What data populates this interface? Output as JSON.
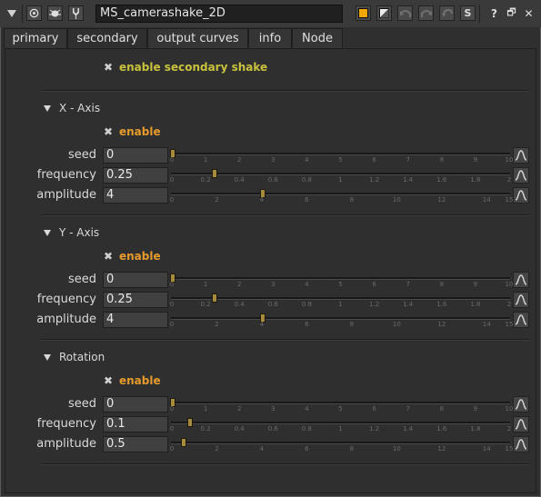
{
  "toolbar": {
    "node_name": "MS_camerashake_2D",
    "icons": [
      "collapse-triangle-icon",
      "center-node-icon",
      "float-panel-icon",
      "settings-icon",
      "node-color-icon",
      "hide-input-icon",
      "undo-icon",
      "redo-icon",
      "revert-icon",
      "s-icon",
      "help-icon",
      "float-icon",
      "close-icon"
    ],
    "s_label": "S",
    "help_label": "?",
    "float_label": "🗗",
    "close_label": "✕"
  },
  "tabs": [
    "primary",
    "secondary",
    "output curves",
    "info",
    "Node"
  ],
  "active_tab": "secondary",
  "secondary": {
    "enable_label": "enable secondary shake",
    "enable_checked": true
  },
  "sections": [
    {
      "title": "X - Axis",
      "enable_label": "enable",
      "rows": [
        {
          "label": "seed",
          "value": "0",
          "fraction": 0.0,
          "ticks": [
            "0",
            "1",
            "2",
            "3",
            "4",
            "5",
            "6",
            "7",
            "8",
            "9",
            "10"
          ]
        },
        {
          "label": "frequency",
          "value": "0.25",
          "fraction": 0.125,
          "ticks": [
            "0",
            "0.2",
            "0.4",
            "0.6",
            "0.8",
            "1",
            "1.2",
            "1.4",
            "1.6",
            "1.8",
            "2"
          ]
        },
        {
          "label": "amplitude",
          "value": "4",
          "fraction": 0.2667,
          "ticks": [
            "0",
            "2",
            "4",
            "6",
            "8",
            "10",
            "12",
            "14",
            "15"
          ]
        }
      ]
    },
    {
      "title": "Y - Axis",
      "enable_label": "enable",
      "rows": [
        {
          "label": "seed",
          "value": "0",
          "fraction": 0.0,
          "ticks": [
            "0",
            "1",
            "2",
            "3",
            "4",
            "5",
            "6",
            "7",
            "8",
            "9",
            "10"
          ]
        },
        {
          "label": "frequency",
          "value": "0.25",
          "fraction": 0.125,
          "ticks": [
            "0",
            "0.2",
            "0.4",
            "0.6",
            "0.8",
            "1",
            "1.2",
            "1.4",
            "1.6",
            "1.8",
            "2"
          ]
        },
        {
          "label": "amplitude",
          "value": "4",
          "fraction": 0.2667,
          "ticks": [
            "0",
            "2",
            "4",
            "6",
            "8",
            "10",
            "12",
            "14",
            "15"
          ]
        }
      ]
    },
    {
      "title": "Rotation",
      "enable_label": "enable",
      "rows": [
        {
          "label": "seed",
          "value": "0",
          "fraction": 0.0,
          "ticks": [
            "0",
            "1",
            "2",
            "3",
            "4",
            "5",
            "6",
            "7",
            "8",
            "9",
            "10"
          ]
        },
        {
          "label": "frequency",
          "value": "0.1",
          "fraction": 0.05,
          "ticks": [
            "0",
            "0.2",
            "0.4",
            "0.6",
            "0.8",
            "1",
            "1.2",
            "1.4",
            "1.6",
            "1.8",
            "2"
          ]
        },
        {
          "label": "amplitude",
          "value": "0.5",
          "fraction": 0.0333,
          "ticks": [
            "0",
            "2",
            "4",
            "6",
            "8",
            "10",
            "12",
            "14",
            "15"
          ]
        }
      ]
    }
  ],
  "colors": {
    "accent_yellow": "#c9c23d",
    "accent_orange": "#e79b2c",
    "handle": "#a58c3c",
    "background": "#2f2f2f"
  }
}
